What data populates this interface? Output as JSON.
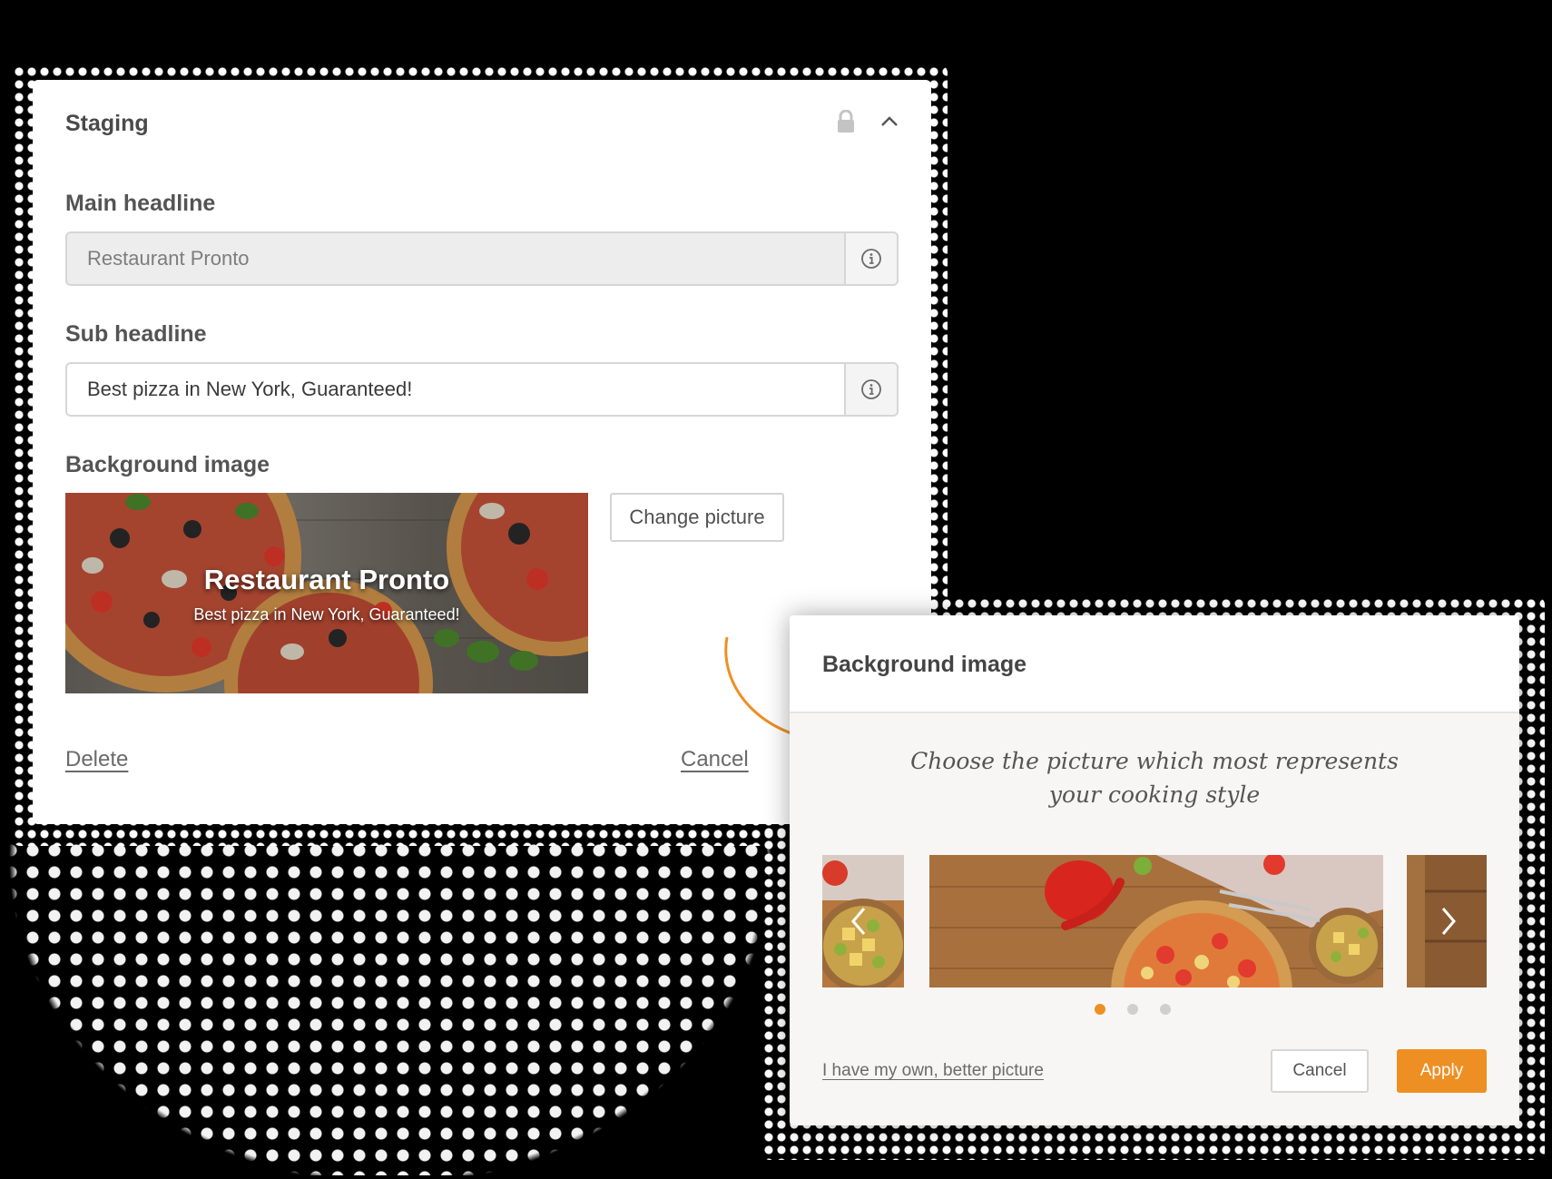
{
  "staging": {
    "title": "Staging",
    "main_headline": {
      "label": "Main headline",
      "value": "Restaurant Pronto"
    },
    "sub_headline": {
      "label": "Sub headline",
      "value": "Best pizza in New York, Guaranteed!"
    },
    "background_image": {
      "label": "Background image",
      "preview_title": "Restaurant Pronto",
      "preview_subtitle": "Best pizza in New York, Guaranteed!",
      "change_label": "Change picture"
    },
    "delete_label": "Delete",
    "cancel_label": "Cancel"
  },
  "dialog": {
    "title": "Background image",
    "prompt_line1": "Choose the picture which most represents",
    "prompt_line2": "your cooking style",
    "carousel": {
      "active_index": 0,
      "total": 3
    },
    "own_picture_label": "I have my own, better picture",
    "cancel_label": "Cancel",
    "apply_label": "Apply"
  },
  "colors": {
    "accent": "#ee8f23",
    "dot_active": "#ee8f23",
    "dot_inactive": "#cfcfcf",
    "text_dark": "#444444"
  }
}
